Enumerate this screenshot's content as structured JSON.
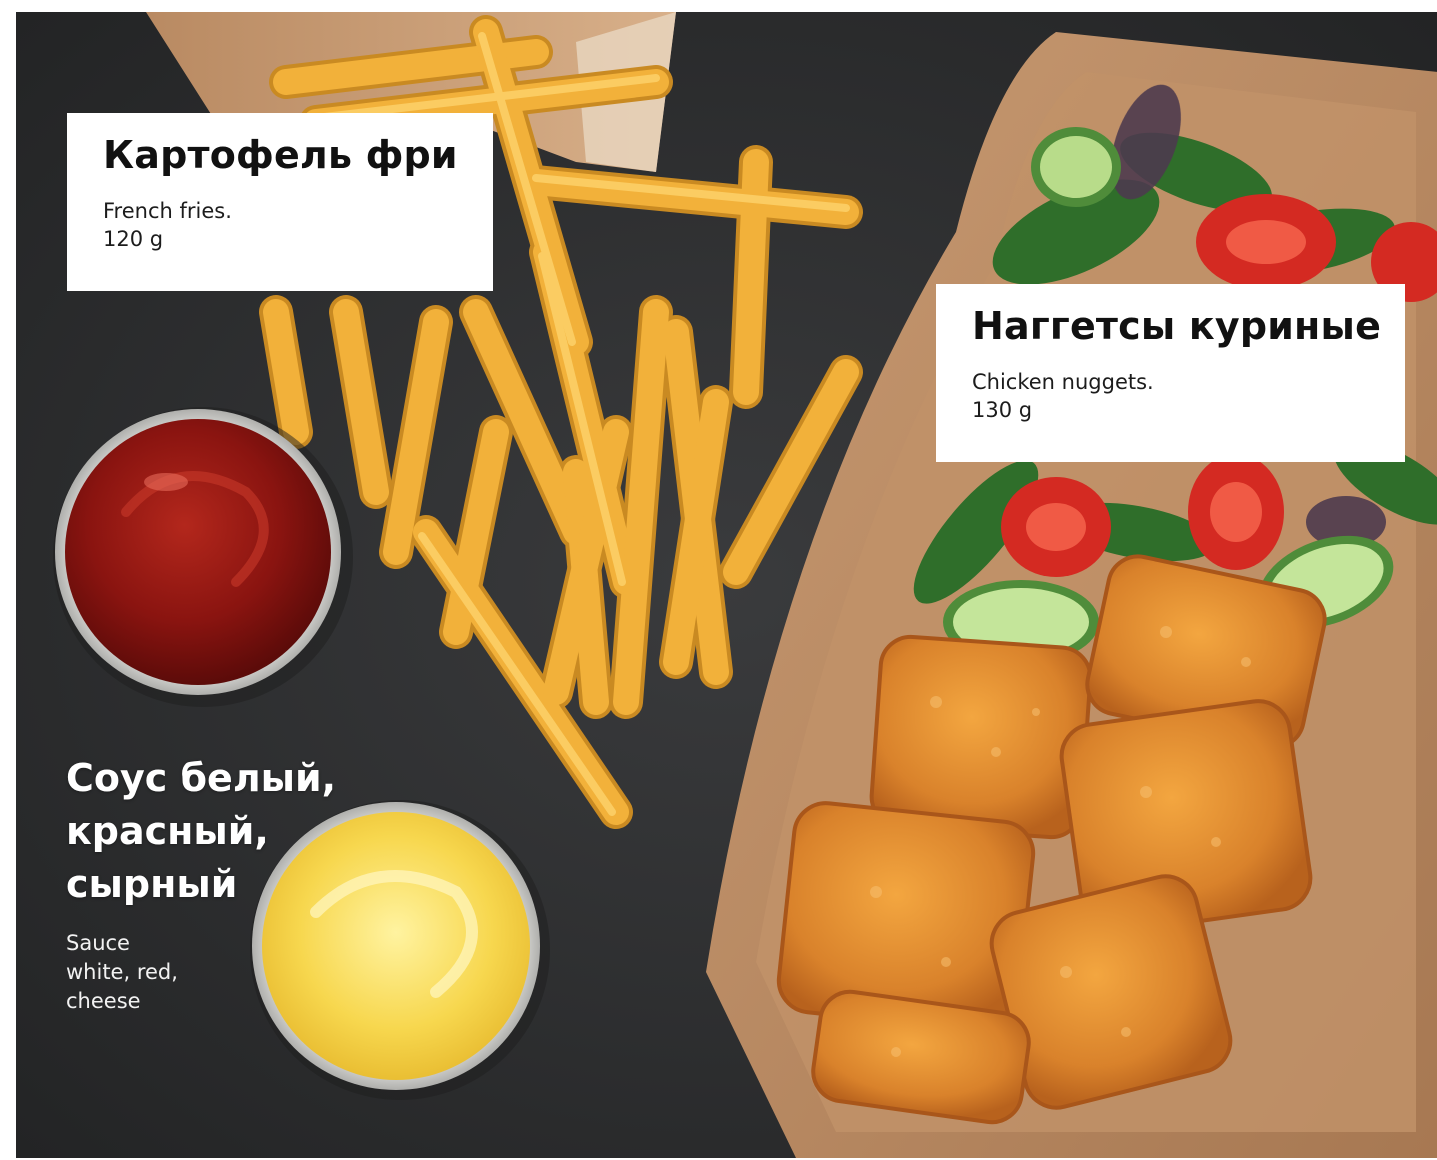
{
  "fries": {
    "title": "Картофель фри",
    "description": "French fries.",
    "weight": "120 g",
    "icon": "french-fries-photo"
  },
  "nuggets": {
    "title": "Наггетсы куриные",
    "description": "Chicken nuggets.",
    "weight": "130 g",
    "icon": "chicken-nuggets-photo"
  },
  "sauce": {
    "title_lines": [
      "Соус белый,",
      "красный,",
      "сырный"
    ],
    "description_lines": [
      "Sauce",
      "white, red,",
      "cheese"
    ],
    "icon": "sauce-cups-photo"
  },
  "colors": {
    "background": "#2f3032",
    "card": "#ffffff",
    "fries": "#f2b13a",
    "ketchup": "#8e1512",
    "cheese_sauce": "#f7d54a",
    "kraft_paper": "#b98a62",
    "nugget": "#d9822b"
  }
}
